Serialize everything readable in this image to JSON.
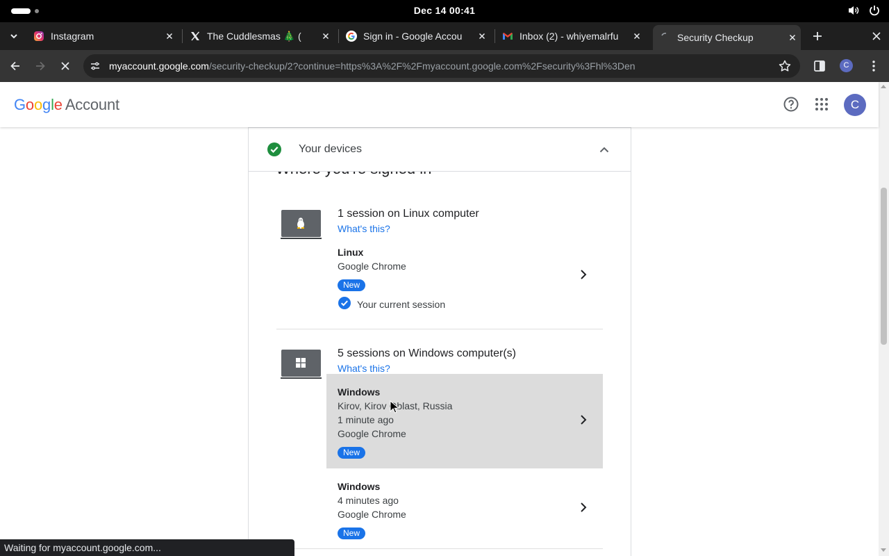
{
  "system": {
    "clock": "Dec 14  00:41"
  },
  "tabs": [
    {
      "title": "Instagram",
      "favicon": "instagram-icon"
    },
    {
      "title": "The Cuddlesmas 🎄 (",
      "favicon": "x-icon"
    },
    {
      "title": "Sign in - Google Accou",
      "favicon": "google-icon"
    },
    {
      "title": "Inbox (2) - whiyemalrfu",
      "favicon": "gmail-icon"
    },
    {
      "title": "Security Checkup",
      "favicon": "loading-icon",
      "active": true
    }
  ],
  "address_bar": {
    "host": "myaccount.google.com",
    "path": "/security-checkup/2?continue=https%3A%2F%2Fmyaccount.google.com%2Fsecurity%3Fhl%3Den"
  },
  "profile_initial": "C",
  "header": {
    "logo_letters": [
      "G",
      "o",
      "o",
      "g",
      "l",
      "e"
    ],
    "logo_colors": [
      "#4285f4",
      "#ea4335",
      "#fbbc05",
      "#4285f4",
      "#34a853",
      "#ea4335"
    ],
    "product": "Account",
    "avatar_initial": "C"
  },
  "panel": {
    "title": "Your devices",
    "section_title": "Where you're signed in"
  },
  "groups": [
    {
      "title": "1 session on Linux computer",
      "whats_this": "What's this?",
      "sessions": [
        {
          "name": "Linux",
          "lines": [
            "Google Chrome"
          ],
          "badge": "New",
          "current": "Your current session"
        }
      ]
    },
    {
      "title": "5 sessions on Windows computer(s)",
      "whats_this": "What's this?",
      "sessions": [
        {
          "name": "Windows",
          "lines": [
            "Kirov, Kirov Oblast, Russia",
            "1 minute ago",
            "Google Chrome"
          ],
          "badge": "New"
        },
        {
          "name": "Windows",
          "lines": [
            "4 minutes ago",
            "Google Chrome"
          ],
          "badge": "New"
        }
      ]
    }
  ],
  "status_bar": "Waiting for myaccount.google.com...",
  "colors": {
    "accent": "#1a73e8",
    "check_green": "#1e8e3e",
    "highlight": "#dcdcdc"
  }
}
